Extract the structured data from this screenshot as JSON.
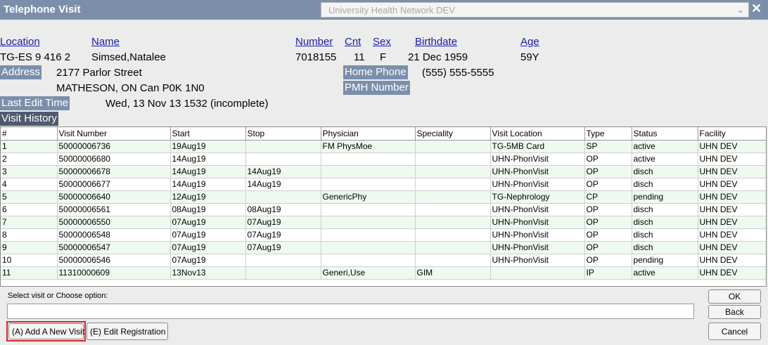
{
  "window": {
    "title": "Telephone Visit",
    "network": "University Health Network DEV",
    "close_glyph": "✕",
    "chevron_glyph": "⌄"
  },
  "patient": {
    "location_label": "Location",
    "location": "TG-ES 9 416 2",
    "name_label": "Name",
    "name": "Simsed,Natalee",
    "number_label": "Number",
    "number": "7018155",
    "cnt_label": "Cnt",
    "cnt": "11",
    "sex_label": "Sex",
    "sex": "F",
    "birthdate_label": "Birthdate",
    "birthdate": "21 Dec 1959",
    "age_label": "Age",
    "age": "59Y",
    "address_label": "Address",
    "address_line1": "2177 Parlor Street",
    "address_line2": "MATHESON, ON  Can  P0K 1N0",
    "home_phone_label": "Home Phone",
    "home_phone": "(555) 555-5555",
    "pmh_label": "PMH Number",
    "last_edit_label": "Last Edit Time",
    "last_edit": "Wed, 13 Nov 13  1532 (incomplete)",
    "visit_history_label": "Visit History"
  },
  "table": {
    "columns": [
      "#",
      "Visit Number",
      "Start",
      "Stop",
      "Physician",
      "Speciality",
      "Visit Location",
      "Type",
      "Status",
      "Facility"
    ],
    "rows": [
      [
        "1",
        "50000006736",
        "19Aug19",
        "",
        "FM PhysMoe",
        "",
        "TG-5MB Card",
        "SP",
        "active",
        "UHN DEV"
      ],
      [
        "2",
        "50000006680",
        "14Aug19",
        "",
        "",
        "",
        "UHN-PhonVisit",
        "OP",
        "active",
        "UHN DEV"
      ],
      [
        "3",
        "50000006678",
        "14Aug19",
        "14Aug19",
        "",
        "",
        "UHN-PhonVisit",
        "OP",
        "disch",
        "UHN DEV"
      ],
      [
        "4",
        "50000006677",
        "14Aug19",
        "14Aug19",
        "",
        "",
        "UHN-PhonVisit",
        "OP",
        "disch",
        "UHN DEV"
      ],
      [
        "5",
        "50000006640",
        "12Aug19",
        "",
        "GenericPhy",
        "",
        "TG-Nephrology",
        "CP",
        "pending",
        "UHN DEV"
      ],
      [
        "6",
        "50000006561",
        "08Aug19",
        "08Aug19",
        "",
        "",
        "UHN-PhonVisit",
        "OP",
        "disch",
        "UHN DEV"
      ],
      [
        "7",
        "50000006550",
        "07Aug19",
        "07Aug19",
        "",
        "",
        "UHN-PhonVisit",
        "OP",
        "disch",
        "UHN DEV"
      ],
      [
        "8",
        "50000006548",
        "07Aug19",
        "07Aug19",
        "",
        "",
        "UHN-PhonVisit",
        "OP",
        "disch",
        "UHN DEV"
      ],
      [
        "9",
        "50000006547",
        "07Aug19",
        "07Aug19",
        "",
        "",
        "UHN-PhonVisit",
        "OP",
        "disch",
        "UHN DEV"
      ],
      [
        "10",
        "50000006546",
        "07Aug19",
        "",
        "",
        "",
        "UHN-PhonVisit",
        "OP",
        "pending",
        "UHN DEV"
      ],
      [
        "11",
        "11310000609",
        "13Nov13",
        "",
        "Generi,Use",
        "GIM",
        "",
        "IP",
        "active",
        "UHN DEV"
      ]
    ]
  },
  "footer": {
    "prompt": "Select visit or Choose option:",
    "input_value": "",
    "add_visit": "(A) Add A New Visit",
    "edit_registration": "(E) Edit Registration",
    "ok": "OK",
    "back": "Back",
    "cancel": "Cancel"
  },
  "colors": {
    "title_bar": "#7b8fab",
    "label_tag": "#7b8fab",
    "visit_history_tag": "#4e5a6f",
    "link": "#1a1aa6",
    "row_alt": "#eefaef",
    "highlight": "#d7262b"
  }
}
